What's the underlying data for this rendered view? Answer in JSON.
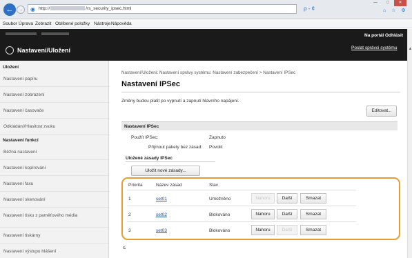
{
  "browser": {
    "address_prefix": "http://",
    "address_suffix": "/rs_security_ipsec.html",
    "address_search": "ρ - ¢",
    "window_min": "—",
    "window_max": "□",
    "window_close": "✕",
    "tools": "⌂ ☆ ⚙"
  },
  "menubar": [
    "Soubor",
    "Úprava",
    "Zobrazit",
    "Oblíbené položky",
    "Nástroje",
    "Nápověda"
  ],
  "header": {
    "title": "Nastavení/Uložení",
    "portal": "Na portál",
    "logout": "Odhlásit",
    "send_email": "Poslat správci systému"
  },
  "sidebar": {
    "group1": "Uložení",
    "items1": [
      "Nastavení papíru",
      "Nastavení zobrazení",
      "Nastavení časovače",
      "Odkládání/Hlasitost zvuku"
    ],
    "group2": "Nastavení funkcí",
    "items2": [
      "Běžná nastavení",
      "Nastavení kopírování",
      "Nastavení faxu",
      "Nastavení skenování",
      "Nastavení tisku z paměťového média",
      "Nastavení tiskárny",
      "Nastavení výstupu hlášení"
    ]
  },
  "main": {
    "breadcrumb": "Nastavení/Uložení: Nastavení správy systému: Nastavení zabezpečení > Nastavení IPSec",
    "title": "Nastavení IPSec",
    "notice": "Změny budou platit po vypnutí a zapnutí hlavního napájení.",
    "edit_button": "Editovat...",
    "section": "Nastavení IPSec",
    "use_ipsec_label": "Použít IPSec:",
    "use_ipsec_value": "Zapnuto",
    "accept_label": "Přijmout pakety bez zásad:",
    "accept_value": "Povolit",
    "stored_policies": "Uložené zásady IPSec",
    "register_button": "Uložit nové zásady...",
    "table": {
      "headers": [
        "Priorita",
        "Název zásad",
        "Stav"
      ],
      "rows": [
        {
          "priority": "1",
          "name": "set01",
          "status": "Umožněno",
          "up": "Nahoru",
          "down": "Další",
          "delete": "Smazat"
        },
        {
          "priority": "2",
          "name": "set02",
          "status": "Blokováno",
          "up": "Nahoru",
          "down": "Další",
          "delete": "Smazat"
        },
        {
          "priority": "3",
          "name": "set03",
          "status": "Blokováno",
          "up": "Nahoru",
          "down": "Další",
          "delete": "Smazat"
        }
      ]
    },
    "to_top": "≤"
  },
  "colors": {
    "header_bg": "#1a1a1a",
    "highlight_frame": "#e89b2e",
    "link": "#1a4fa0",
    "back_button": "#2e6fc4"
  }
}
